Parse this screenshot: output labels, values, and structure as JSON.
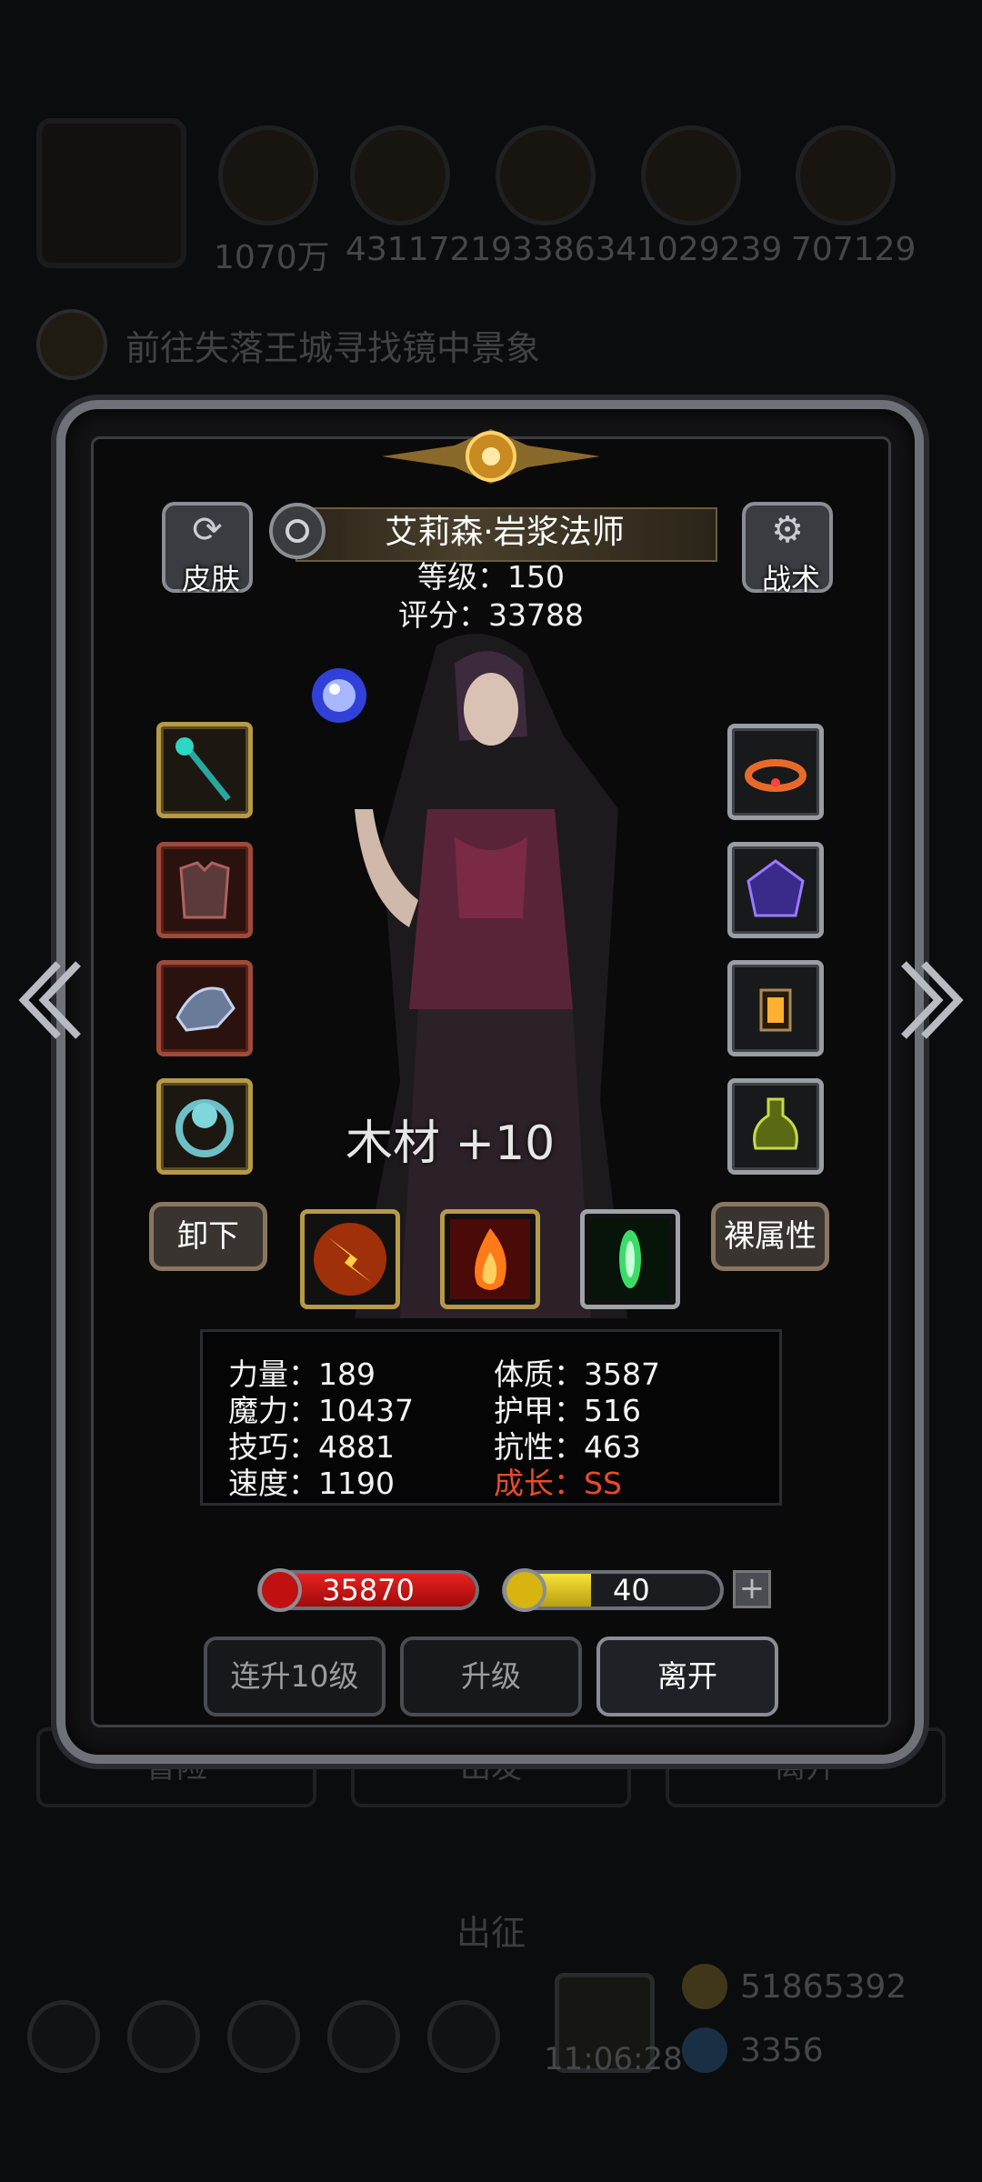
{
  "background": {
    "resources": [
      "1070万",
      "4311721",
      "9338634",
      "1029239",
      "707129"
    ],
    "quest": "前往失落王城寻找镜中景象",
    "tabs": [
      "冒险",
      "出发",
      "离开"
    ],
    "depart": "出征",
    "time": "11:06:28",
    "gold": "51865392",
    "gems": "3356"
  },
  "hero": {
    "name": "艾莉森·岩浆法师",
    "level_line": "等级：150",
    "score_line": "评分：33788"
  },
  "side_buttons": {
    "skin": "皮肤",
    "tactics": "战术"
  },
  "left_slots": [
    "staff-icon",
    "armor-icon",
    "dragon-helmet-icon",
    "skull-ring-icon"
  ],
  "right_slots": [
    "crown-icon",
    "magic-gem-icon",
    "lantern-icon",
    "potion-icon"
  ],
  "material_text": "木材 +10",
  "buttons": {
    "unequip": "卸下",
    "naked_attr": "裸属性"
  },
  "skills": [
    "lightning-burst-icon",
    "flame-icon",
    "green-crystal-icon"
  ],
  "stats": {
    "strength": "力量：189",
    "magic": "魔力：10437",
    "skill": "技巧：4881",
    "speed": "速度：1190",
    "constitution": "体质：3587",
    "armor": "护甲：516",
    "resistance": "抗性：463",
    "growth": "成长：SS"
  },
  "bars": {
    "hp": "35870",
    "hp_fill": 1.0,
    "energy": "40",
    "energy_fill": 0.4,
    "plus": "+"
  },
  "actions": {
    "level_up_10": "连升10级",
    "level_up": "升级",
    "leave": "离开"
  },
  "colors": {
    "growth": "#e84b2a",
    "hp": "#d01515",
    "energy": "#e8d21a",
    "gold_border": "#b79a47"
  }
}
